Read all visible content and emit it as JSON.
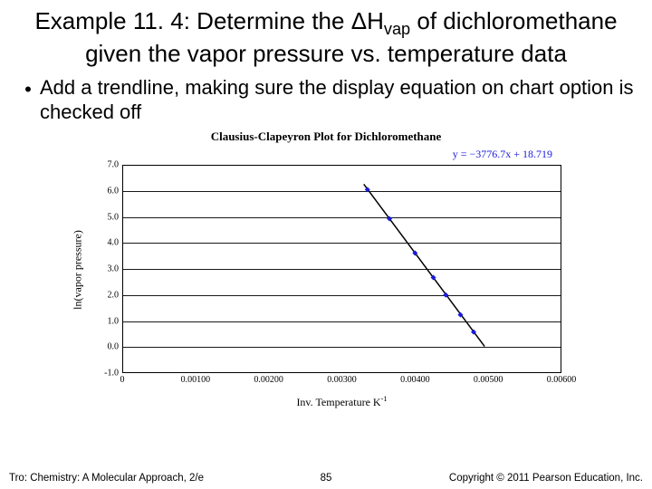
{
  "title": {
    "pre": "Example 11. 4: Determine the ",
    "delta": "Δ",
    "Hsym": "H",
    "sub": "vap",
    "post": " of dichloromethane given the vapor pressure vs. temperature data"
  },
  "bullet": {
    "dot": "•",
    "text": "Add a trendline, making sure the display equation on chart option is checked off"
  },
  "chart_data": {
    "type": "scatter",
    "title": "Clausius-Clapeyron Plot for Dichloromethane",
    "equation": "y = −3776.7x + 18.719",
    "xlabel_html": "Inv. Temperature K",
    "xlabel_sup": "-1",
    "ylabel": "ln(vapor pressure)",
    "xlim": [
      0,
      0.006
    ],
    "ylim": [
      -1.0,
      7.0
    ],
    "xticks": [
      "0",
      "0.00100",
      "0.00200",
      "0.00300",
      "0.00400",
      "0.00500",
      "0.00600"
    ],
    "yticks": [
      "-1.0",
      "0.0",
      "1.0",
      "2.0",
      "3.0",
      "4.0",
      "5.0",
      "6.0",
      "7.0"
    ],
    "series": [
      {
        "name": "data",
        "type": "scatter",
        "points": [
          {
            "x": 0.00335,
            "y": 6.05
          },
          {
            "x": 0.00365,
            "y": 4.93
          },
          {
            "x": 0.004,
            "y": 3.61
          },
          {
            "x": 0.00425,
            "y": 2.67
          },
          {
            "x": 0.00442,
            "y": 2.0
          },
          {
            "x": 0.00462,
            "y": 1.24
          },
          {
            "x": 0.0048,
            "y": 0.58
          }
        ]
      },
      {
        "name": "trendline",
        "type": "line",
        "slope": -3776.7,
        "intercept": 18.719,
        "x_range": [
          0.0033,
          0.00495
        ]
      }
    ]
  },
  "footer": {
    "left": "Tro: Chemistry: A Molecular Approach, 2/e",
    "mid": "85",
    "right": "Copyright © 2011 Pearson Education, Inc."
  }
}
